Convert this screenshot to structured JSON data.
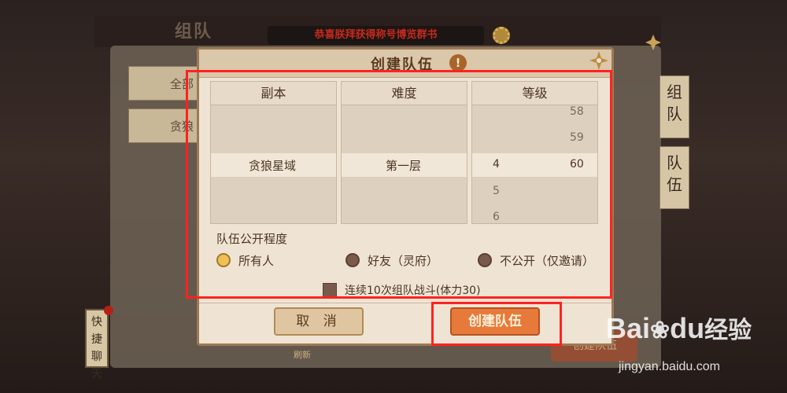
{
  "background": {
    "title": "组队",
    "banner": "恭喜朕拜获得称号博览群书",
    "left_buttons": [
      "全部",
      "贪狼"
    ],
    "right_tabs": [
      "组队",
      "队伍"
    ],
    "side_chat": "快捷聊天",
    "refresh_label": "刷新",
    "create_button": "创建队伍"
  },
  "dialog": {
    "title": "创建队伍",
    "info_glyph": "!",
    "columns": [
      {
        "header": "副本",
        "selected": "贪狼星域"
      },
      {
        "header": "难度",
        "selected": "第一层"
      },
      {
        "header": "等级",
        "min_values": [
          "4",
          "5",
          "6"
        ],
        "max_values": [
          "58",
          "59",
          "60"
        ],
        "selected_min": "4",
        "selected_max": "60"
      }
    ],
    "visibility_label": "队伍公开程度",
    "visibility_options": [
      {
        "label": "所有人",
        "selected": true
      },
      {
        "label": "好友（灵府）",
        "selected": false
      },
      {
        "label": "不公开（仅邀请）",
        "selected": false
      }
    ],
    "repeat_checkbox_label": "连续10次组队战斗(体力30)",
    "cancel_label": "取 消",
    "create_label": "创建队伍"
  },
  "watermark": {
    "logo": "Bai",
    "logo2": "du",
    "text": "经验",
    "url": "jingyan.baidu.com"
  },
  "colors": {
    "highlight": "#ff2222",
    "accent": "#e77a3a"
  }
}
